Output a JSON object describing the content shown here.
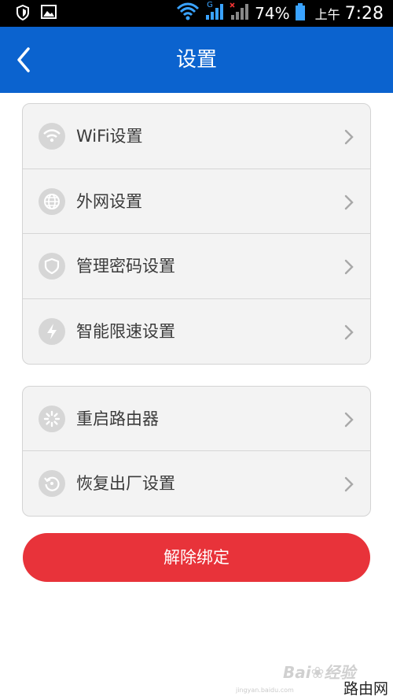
{
  "status_bar": {
    "battery_percent": "74%",
    "ampm": "上午",
    "time": "7:28",
    "network_type": "G",
    "icons": [
      "shield-icon",
      "image-icon",
      "wifi-icon",
      "signal-icon",
      "signal-x-icon",
      "battery-icon"
    ]
  },
  "header": {
    "title": "设置",
    "color": "#0b63cf"
  },
  "settings_group_1": [
    {
      "label": "WiFi设置",
      "icon": "wifi-icon"
    },
    {
      "label": "外网设置",
      "icon": "globe-icon"
    },
    {
      "label": "管理密码设置",
      "icon": "shield-icon"
    },
    {
      "label": "智能限速设置",
      "icon": "lightning-icon"
    }
  ],
  "settings_group_2": [
    {
      "label": "重启路由器",
      "icon": "restart-spinner-icon"
    },
    {
      "label": "恢复出厂设置",
      "icon": "restore-icon"
    }
  ],
  "unbind_button": {
    "label": "解除绑定",
    "color": "#e8333a"
  },
  "watermark": {
    "brand": "Bai",
    "brand_suffix": "经验",
    "url": "jingyan.baidu.com",
    "site": "路由网"
  }
}
